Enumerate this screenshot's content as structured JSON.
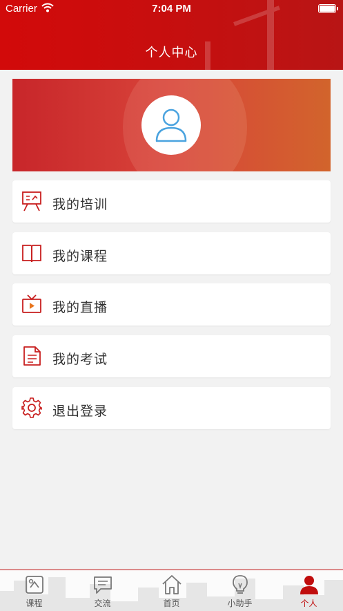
{
  "status_bar": {
    "carrier": "Carrier",
    "time": "7:04 PM"
  },
  "header": {
    "title": "个人中心"
  },
  "profile": {
    "avatar_icon": "user-avatar-icon"
  },
  "menu": [
    {
      "label": "我的培训",
      "icon": "training-board-icon"
    },
    {
      "label": "我的课程",
      "icon": "book-icon"
    },
    {
      "label": "我的直播",
      "icon": "tv-live-icon"
    },
    {
      "label": "我的考试",
      "icon": "document-exam-icon"
    },
    {
      "label": "退出登录",
      "icon": "gear-icon"
    }
  ],
  "tabbar": {
    "tabs": [
      {
        "label": "课程",
        "icon": "courses-icon",
        "active": false
      },
      {
        "label": "交流",
        "icon": "chat-icon",
        "active": false
      },
      {
        "label": "首页",
        "icon": "home-icon",
        "active": false
      },
      {
        "label": "小助手",
        "icon": "lightbulb-icon",
        "active": false
      },
      {
        "label": "个人",
        "icon": "person-icon",
        "active": true
      }
    ]
  },
  "colors": {
    "accent": "#c00d0d",
    "avatar_stroke": "#4aa3df",
    "icon_red": "#c81e1e"
  }
}
